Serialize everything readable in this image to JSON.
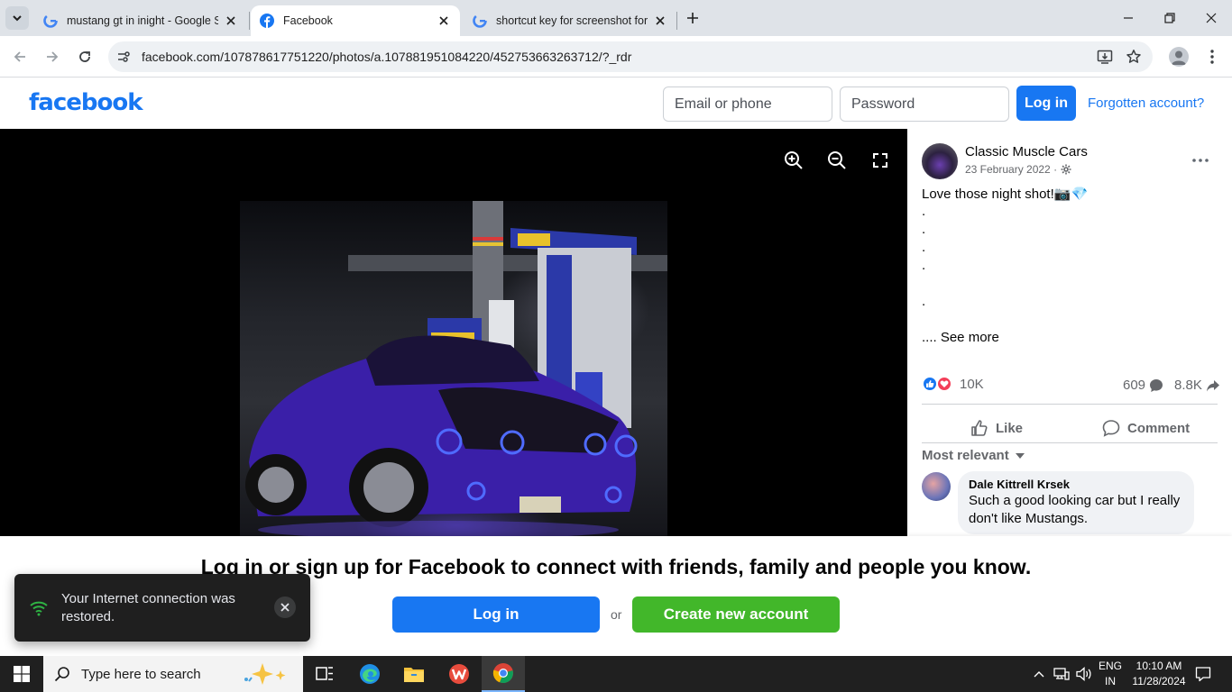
{
  "browser": {
    "tabs": [
      {
        "title": "mustang gt in inight - Google S",
        "favicon": "google-icon",
        "active": false
      },
      {
        "title": "Facebook",
        "favicon": "facebook-icon",
        "active": true
      },
      {
        "title": "shortcut key for screenshot for",
        "favicon": "google-icon",
        "active": false
      }
    ],
    "url": "facebook.com/107878617751220/photos/a.107881951084220/452753663263712/?_rdr"
  },
  "header": {
    "logo": "facebook",
    "email_placeholder": "Email or phone",
    "password_placeholder": "Password",
    "login_label": "Log in",
    "forgot_label": "Forgotten account?"
  },
  "post": {
    "page_name": "Classic Muscle Cars",
    "date": "23 February 2022 ·",
    "caption": "Love those night shot!📷💎",
    "dots": [
      ".",
      ".",
      ".",
      ".",
      "."
    ],
    "see_more": ".... See more",
    "reactions_count": "10K",
    "comments_count": "609",
    "shares_count": "8.8K",
    "like_label": "Like",
    "comment_label": "Comment",
    "sort_label": "Most relevant",
    "comment": {
      "author": "Dale Kittrell Krsek",
      "text": "Such a good looking car but I really don't like Mustangs."
    }
  },
  "banner": {
    "title": "Log in or sign up for Facebook to connect with friends, family and people you know.",
    "login_label": "Log in",
    "or_label": "or",
    "create_label": "Create new account"
  },
  "toast": {
    "message": "Your Internet connection was restored."
  },
  "taskbar": {
    "search_placeholder": "Type here to search",
    "lang_top": "ENG",
    "lang_bottom": "IN",
    "time": "10:10 AM",
    "date": "11/28/2024"
  },
  "colors": {
    "fb_blue": "#1877f2",
    "fb_green": "#42b72a",
    "taskbar": "#202020"
  }
}
